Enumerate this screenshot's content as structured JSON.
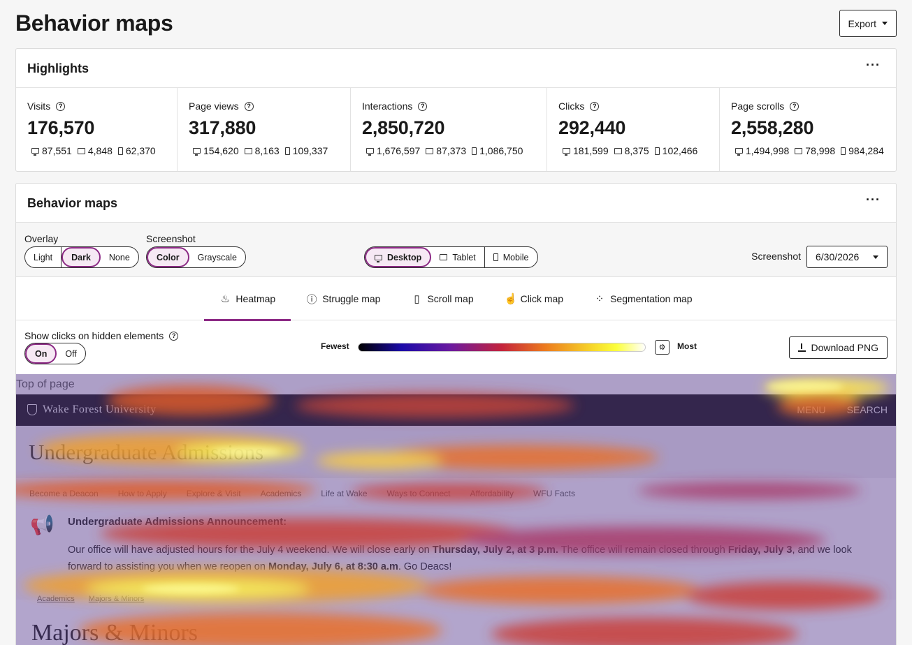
{
  "page": {
    "title": "Behavior maps",
    "export_label": "Export"
  },
  "highlights": {
    "title": "Highlights",
    "metrics": [
      {
        "label": "Visits",
        "value": "176,570",
        "desktop": "87,551",
        "tablet": "4,848",
        "mobile": "62,370"
      },
      {
        "label": "Page views",
        "value": "317,880",
        "desktop": "154,620",
        "tablet": "8,163",
        "mobile": "109,337"
      },
      {
        "label": "Interactions",
        "value": "2,850,720",
        "desktop": "1,676,597",
        "tablet": "87,373",
        "mobile": "1,086,750"
      },
      {
        "label": "Clicks",
        "value": "292,440",
        "desktop": "181,599",
        "tablet": "8,375",
        "mobile": "102,466"
      },
      {
        "label": "Page scrolls",
        "value": "2,558,280",
        "desktop": "1,494,998",
        "tablet": "78,998",
        "mobile": "984,284"
      }
    ]
  },
  "behavior_maps": {
    "title": "Behavior maps",
    "overlay": {
      "label": "Overlay",
      "options": [
        "Light",
        "Dark",
        "None"
      ],
      "selected": "Dark"
    },
    "screenshot_mode": {
      "label": "Screenshot",
      "options": [
        "Color",
        "Grayscale"
      ],
      "selected": "Color"
    },
    "devices": {
      "options": [
        "Desktop",
        "Tablet",
        "Mobile"
      ],
      "selected": "Desktop"
    },
    "screenshot_date": {
      "label": "Screenshot",
      "value": "6/30/2026"
    },
    "tabs": [
      {
        "label": "Heatmap",
        "icon": "flame-icon"
      },
      {
        "label": "Struggle map",
        "icon": "alert-circle-icon"
      },
      {
        "label": "Scroll map",
        "icon": "mouse-icon"
      },
      {
        "label": "Click map",
        "icon": "pointer-icon"
      },
      {
        "label": "Segmentation map",
        "icon": "scatter-icon"
      }
    ],
    "active_tab": "Heatmap",
    "hidden_clicks": {
      "label": "Show clicks on hidden elements",
      "options": [
        "On",
        "Off"
      ],
      "selected": "On"
    },
    "legend": {
      "min_label": "Fewest",
      "max_label": "Most"
    },
    "download_label": "Download PNG"
  },
  "website": {
    "top_marker": "Top of page",
    "logo": "Wake Forest University",
    "nav_menu": "MENU",
    "nav_search": "SEARCH",
    "hero_title": "Undergraduate Admissions",
    "menu_items": [
      "Become a Deacon",
      "How to Apply",
      "Explore & Visit",
      "Academics",
      "Life at Wake",
      "Ways to Connect",
      "Affordability",
      "WFU Facts"
    ],
    "announcement": {
      "title": "Undergraduate Admissions Announcement:",
      "body_1": "Our office will have adjusted hours for the July 4 weekend. We will close early on ",
      "bold_1": "Thursday, July 2, at 3 p.m.",
      "body_2": " The office will remain closed through ",
      "bold_2": "Friday, July 3",
      "body_3": ", and we look forward to assisting you when we reopen on ",
      "bold_3": "Monday, July 6, at 8:30 a.m",
      "body_4": ". Go Deacs!"
    },
    "breadcrumb": [
      "Academics",
      "Majors & Minors"
    ],
    "section_title": "Majors & Minors"
  }
}
